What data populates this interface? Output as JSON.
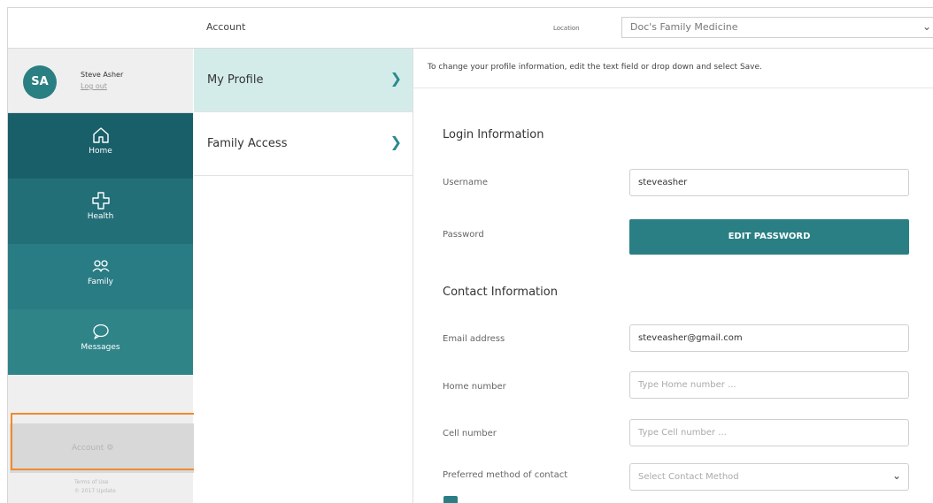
{
  "topbar": {
    "breadcrumb": "Account",
    "location_label": "Location",
    "location_value": "Doc's Family Medicine"
  },
  "user": {
    "initials": "SA",
    "name": "Steve Asher",
    "logout": "Log out"
  },
  "nav": [
    {
      "label": "Home",
      "icon": "home-icon"
    },
    {
      "label": "Health",
      "icon": "cross-icon"
    },
    {
      "label": "Family",
      "icon": "people-icon"
    },
    {
      "label": "Messages",
      "icon": "chat-icon"
    }
  ],
  "account_tab": {
    "label": "Account",
    "icon": "gear-icon"
  },
  "footer": {
    "line1": "Terms of Use",
    "line2": "© 2017 Update"
  },
  "menu": [
    {
      "label": "My Profile"
    },
    {
      "label": "Family Access"
    }
  ],
  "content": {
    "hint": "To change your profile information, edit the text field or drop down and select Save.",
    "login_title": "Login Information",
    "username_label": "Username",
    "username_value": "steveasher",
    "password_label": "Password",
    "edit_password": "EDIT PASSWORD",
    "contact_title": "Contact Information",
    "email_label": "Email address",
    "email_value": "steveasher@gmail.com",
    "home_label": "Home number",
    "home_placeholder": "Type Home number ...",
    "cell_label": "Cell number",
    "cell_placeholder": "Type Cell number ...",
    "preferred_label": "Preferred method of contact",
    "preferred_placeholder": "Select Contact Method"
  },
  "colors": {
    "brand": "#2a7f84",
    "nav_dark": "#195f69",
    "highlight": "#f08a2c",
    "selected_row": "#d3ecea"
  }
}
